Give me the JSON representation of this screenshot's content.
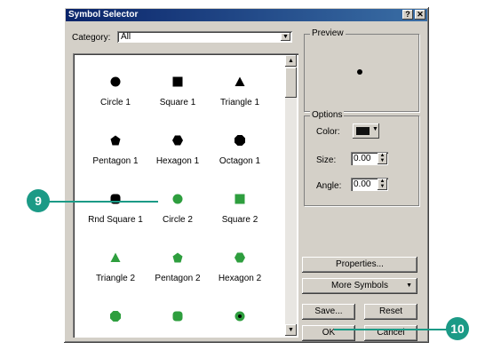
{
  "dialog": {
    "title": "Symbol Selector",
    "help_glyph": "?",
    "close_glyph": "✕"
  },
  "category": {
    "label": "Category:",
    "value": "All"
  },
  "symbols": [
    {
      "label": "Circle 1",
      "shape": "circle",
      "color": "#000000"
    },
    {
      "label": "Square 1",
      "shape": "square",
      "color": "#000000"
    },
    {
      "label": "Triangle 1",
      "shape": "triangle",
      "color": "#000000"
    },
    {
      "label": "Pentagon 1",
      "shape": "pentagon",
      "color": "#000000"
    },
    {
      "label": "Hexagon 1",
      "shape": "hexagon",
      "color": "#000000"
    },
    {
      "label": "Octagon 1",
      "shape": "octagon",
      "color": "#000000"
    },
    {
      "label": "Rnd Square 1",
      "shape": "rnd-square",
      "color": "#000000"
    },
    {
      "label": "Circle 2",
      "shape": "circle",
      "color": "#2e9e3e"
    },
    {
      "label": "Square 2",
      "shape": "square",
      "color": "#2e9e3e"
    },
    {
      "label": "Triangle 2",
      "shape": "triangle",
      "color": "#2e9e3e"
    },
    {
      "label": "Pentagon 2",
      "shape": "pentagon",
      "color": "#2e9e3e"
    },
    {
      "label": "Hexagon 2",
      "shape": "hexagon",
      "color": "#2e9e3e"
    },
    {
      "label": "",
      "shape": "octagon",
      "color": "#2e9e3e"
    },
    {
      "label": "",
      "shape": "rnd-square",
      "color": "#2e9e3e"
    },
    {
      "label": "",
      "shape": "target",
      "color": "#2e9e3e"
    }
  ],
  "preview": {
    "title": "Preview"
  },
  "options": {
    "title": "Options",
    "color_label": "Color:",
    "size_label": "Size:",
    "size_value": "0.00",
    "angle_label": "Angle:",
    "angle_value": "0.00"
  },
  "buttons": {
    "properties": "Properties...",
    "more_symbols": "More Symbols",
    "save": "Save...",
    "reset": "Reset",
    "ok": "OK",
    "cancel": "Cancel"
  },
  "callouts": {
    "left": "9",
    "right": "10",
    "color": "#1b9a86"
  }
}
